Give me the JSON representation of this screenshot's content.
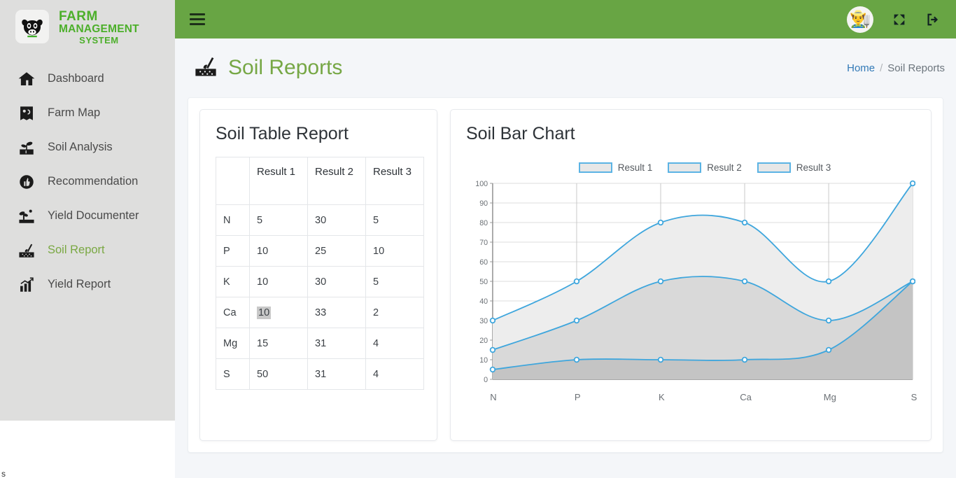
{
  "brand": {
    "line1": "FARM",
    "line2": "MANAGEMENT",
    "line3": "SYSTEM",
    "logo_icon": "cow-head-icon",
    "color": "#4caf2a"
  },
  "sidebar": {
    "items": [
      {
        "label": "Dashboard",
        "icon": "house-icon",
        "active": false
      },
      {
        "label": "Farm Map",
        "icon": "map-icon",
        "active": false
      },
      {
        "label": "Soil Analysis",
        "icon": "seedling-soil-icon",
        "active": false
      },
      {
        "label": "Recommendation",
        "icon": "thumbs-up-circle-icon",
        "active": false
      },
      {
        "label": "Yield Documenter",
        "icon": "field-camera-icon",
        "active": false
      },
      {
        "label": "Soil Report",
        "icon": "soil-shovel-icon",
        "active": true
      },
      {
        "label": "Yield Report",
        "icon": "bar-chart-icon",
        "active": false
      }
    ],
    "active_color": "#7aa843",
    "background": "#dededd"
  },
  "topbar": {
    "background": "#68a544",
    "menu_icon": "hamburger-icon",
    "avatar_icon": "farmer-avatar",
    "avatar_glyph": "👨‍🌾",
    "fullscreen_icon": "expand-arrows-icon",
    "logout_icon": "logout-icon"
  },
  "page": {
    "title": "Soil Reports",
    "title_icon": "soil-shovel-icon",
    "title_color": "#76a745",
    "breadcrumb": {
      "home": "Home",
      "separator": "/",
      "current": "Soil Reports"
    }
  },
  "table_card": {
    "title": "Soil Table Report",
    "columns": [
      "",
      "Result 1",
      "Result 2",
      "Result 3"
    ],
    "rows": [
      {
        "nutrient": "N",
        "result1": "5",
        "result2": "30",
        "result3": "5"
      },
      {
        "nutrient": "P",
        "result1": "10",
        "result2": "25",
        "result3": "10"
      },
      {
        "nutrient": "K",
        "result1": "10",
        "result2": "30",
        "result3": "5"
      },
      {
        "nutrient": "Ca",
        "result1": "10",
        "result2": "33",
        "result3": "2",
        "selected_cell": "result1"
      },
      {
        "nutrient": "Mg",
        "result1": "15",
        "result2": "31",
        "result3": "4"
      },
      {
        "nutrient": "S",
        "result1": "50",
        "result2": "31",
        "result3": "4"
      }
    ]
  },
  "chart_card": {
    "title": "Soil Bar Chart"
  },
  "chart_data": {
    "type": "area",
    "title": "Soil Bar Chart",
    "xlabel": "",
    "ylabel": "",
    "categories": [
      "N",
      "P",
      "K",
      "Ca",
      "Mg",
      "S"
    ],
    "ylim": [
      0,
      100
    ],
    "yticks": [
      0,
      10,
      20,
      30,
      40,
      50,
      60,
      70,
      80,
      90,
      100
    ],
    "grid": true,
    "legend_position": "top-center",
    "smooth": true,
    "line_color": "#3ea6dd",
    "series": [
      {
        "name": "Result 1",
        "values": [
          30,
          50,
          80,
          80,
          50,
          100
        ],
        "fill": "#ededed"
      },
      {
        "name": "Result 2",
        "values": [
          15,
          30,
          50,
          50,
          30,
          50
        ],
        "fill": "#d9d9d9"
      },
      {
        "name": "Result 3",
        "values": [
          5,
          10,
          10,
          10,
          15,
          50
        ],
        "fill": "#c4c4c4"
      }
    ]
  },
  "misc": {
    "bottom_stray_text": "s"
  }
}
